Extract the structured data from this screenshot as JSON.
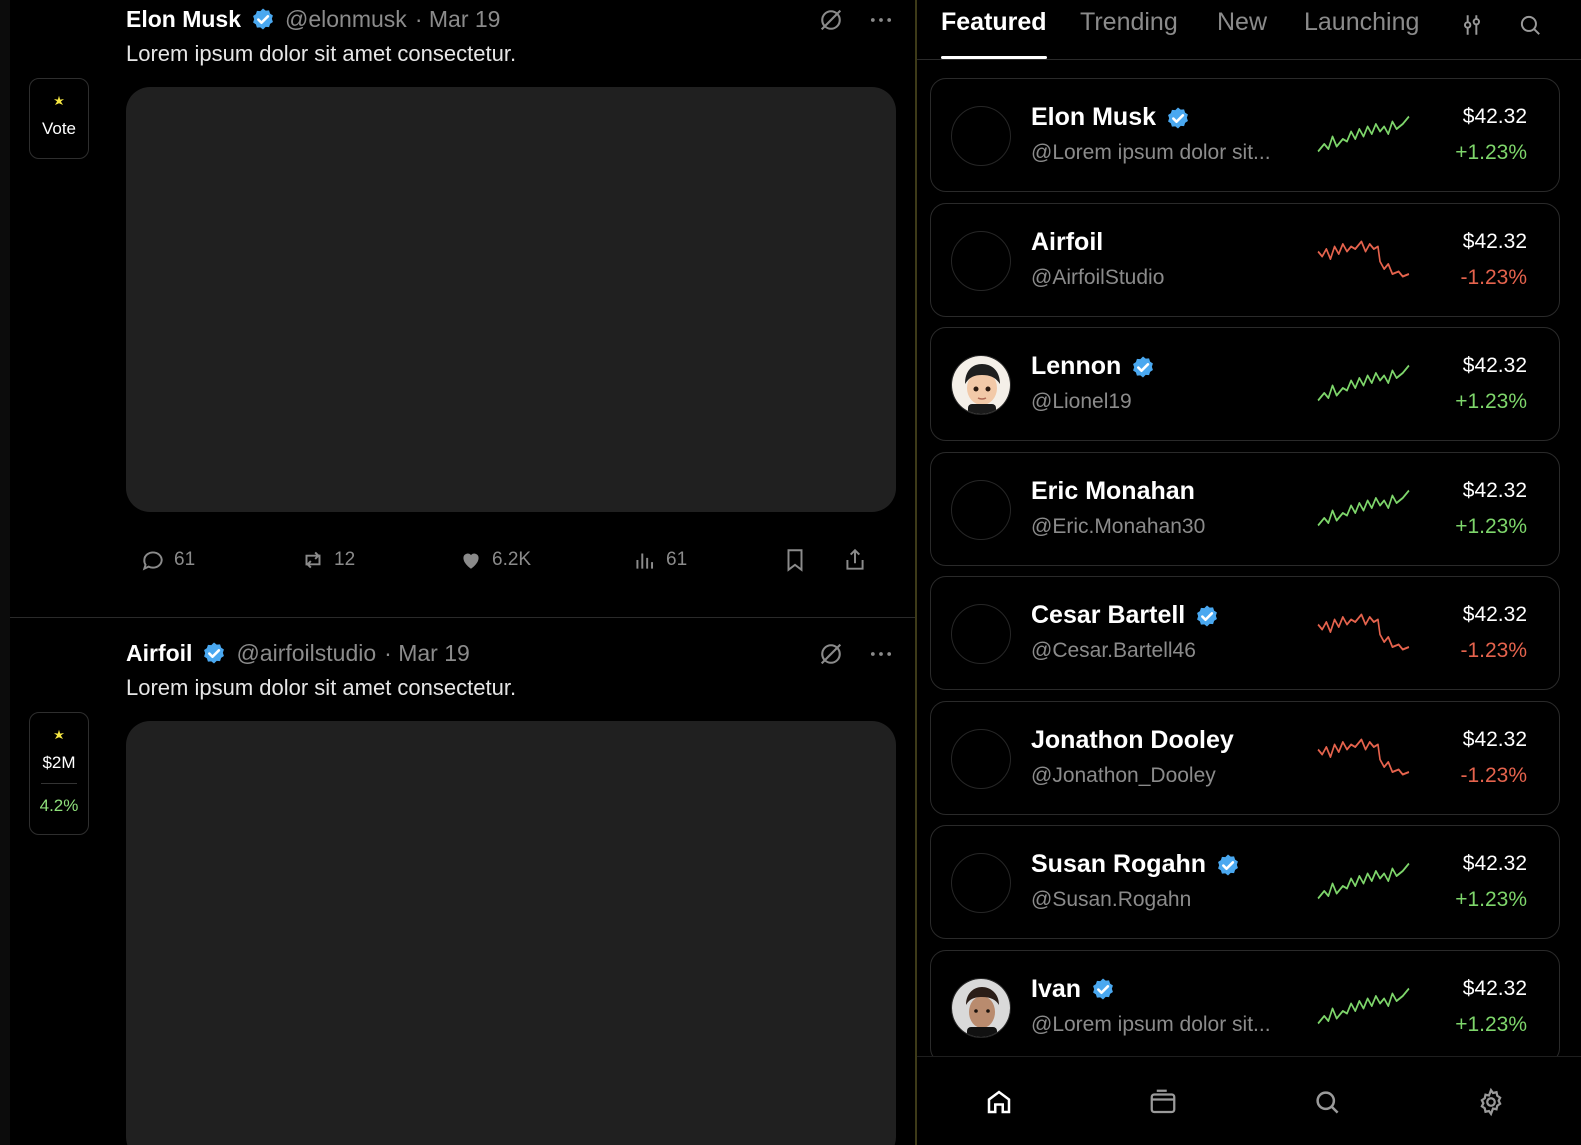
{
  "feed": {
    "posts": [
      {
        "author": "Elon Musk",
        "handle": "@elonmusk",
        "date": "· Mar 19",
        "text": "Lorem ipsum dolor sit amet consectetur.",
        "vote": {
          "label": "Vote"
        },
        "actions": {
          "replies": "61",
          "reposts": "12",
          "likes": "6.2K",
          "views": "61"
        }
      },
      {
        "author": "Airfoil",
        "handle": "@airfoilstudio",
        "date": "· Mar 19",
        "text": "Lorem ipsum dolor sit amet consectetur.",
        "vote": {
          "label": "$2M",
          "pct": "4.2%"
        }
      }
    ]
  },
  "tabs": [
    "Featured",
    "Trending",
    "New",
    "Launching"
  ],
  "list": [
    {
      "name": "Elon Musk",
      "sub": "@Lorem ipsum dolor sit...",
      "price": "$42.32",
      "change": "+1.23%",
      "verified": true,
      "trend": "up"
    },
    {
      "name": "Airfoil",
      "sub": "@AirfoilStudio",
      "price": "$42.32",
      "change": "-1.23%",
      "verified": false,
      "trend": "down"
    },
    {
      "name": "Lennon",
      "sub": "@Lionel19",
      "price": "$42.32",
      "change": "+1.23%",
      "verified": true,
      "trend": "up"
    },
    {
      "name": "Eric Monahan",
      "sub": "@Eric.Monahan30",
      "price": "$42.32",
      "change": "+1.23%",
      "verified": false,
      "trend": "up"
    },
    {
      "name": "Cesar Bartell",
      "sub": "@Cesar.Bartell46",
      "price": "$42.32",
      "change": "-1.23%",
      "verified": true,
      "trend": "down"
    },
    {
      "name": "Jonathon Dooley",
      "sub": "@Jonathon_Dooley",
      "price": "$42.32",
      "change": "-1.23%",
      "verified": false,
      "trend": "down"
    },
    {
      "name": "Susan Rogahn",
      "sub": "@Susan.Rogahn",
      "price": "$42.32",
      "change": "+1.23%",
      "verified": true,
      "trend": "up"
    },
    {
      "name": "Ivan",
      "sub": "@Lorem ipsum dolor sit...",
      "price": "$42.32",
      "change": "+1.23%",
      "verified": true,
      "trend": "up"
    }
  ],
  "colors": {
    "up": "#7ed66b",
    "down": "#e5634d",
    "verified": "#4aa8f0",
    "accent_yellow": "#f5e642"
  }
}
